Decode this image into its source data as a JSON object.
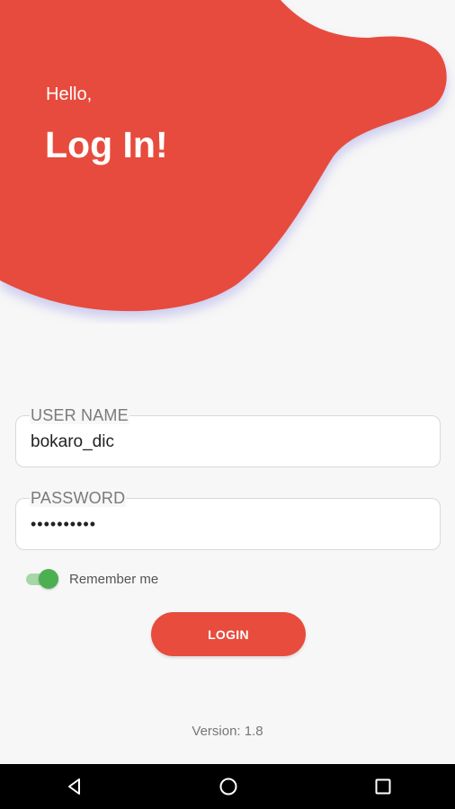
{
  "header": {
    "greeting": "Hello,",
    "title": "Log In!"
  },
  "form": {
    "username": {
      "label": "USER NAME",
      "value": "bokaro_dic"
    },
    "password": {
      "label": "PASSWORD",
      "masked_value": "••••••••••"
    },
    "remember": {
      "label": "Remember me",
      "checked": true
    },
    "login_label": "LOGIN"
  },
  "footer": {
    "version": "Version: 1.8"
  },
  "navbar": {
    "icons": [
      "back-icon",
      "home-icon",
      "recents-icon"
    ]
  },
  "colors": {
    "accent": "#e74c3c",
    "toggle_on": "#4caf50",
    "background": "#f7f7f7"
  }
}
